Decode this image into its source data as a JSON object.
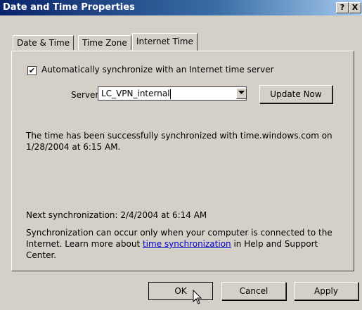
{
  "window": {
    "title": "Date and Time Properties",
    "help_glyph": "?",
    "close_glyph": "X"
  },
  "tabs": [
    {
      "label": "Date & Time",
      "active": false
    },
    {
      "label": "Time Zone",
      "active": false
    },
    {
      "label": "Internet Time",
      "active": true
    }
  ],
  "sync": {
    "auto_checked": true,
    "check_glyph": "✔",
    "auto_label": "Automatically synchronize with an Internet time server",
    "server_label": "Server:",
    "server_value": "LC_VPN_internal",
    "update_button": "Update Now",
    "status_message": "The time has been successfully synchronized with time.windows.com on 1/28/2004 at 6:15 AM.",
    "next_sync": "Next synchronization: 2/4/2004 at 6:14 AM",
    "note_before": "Synchronization can occur only when your computer is connected to the Internet.  Learn more about ",
    "note_link": "time synchronization",
    "note_after": " in Help and Support Center."
  },
  "buttons": {
    "ok": "OK",
    "cancel": "Cancel",
    "apply": "Apply"
  },
  "colors": {
    "title_bar": "#0a246a",
    "dialog_bg": "#d4d0c8",
    "link": "#0000cc"
  }
}
